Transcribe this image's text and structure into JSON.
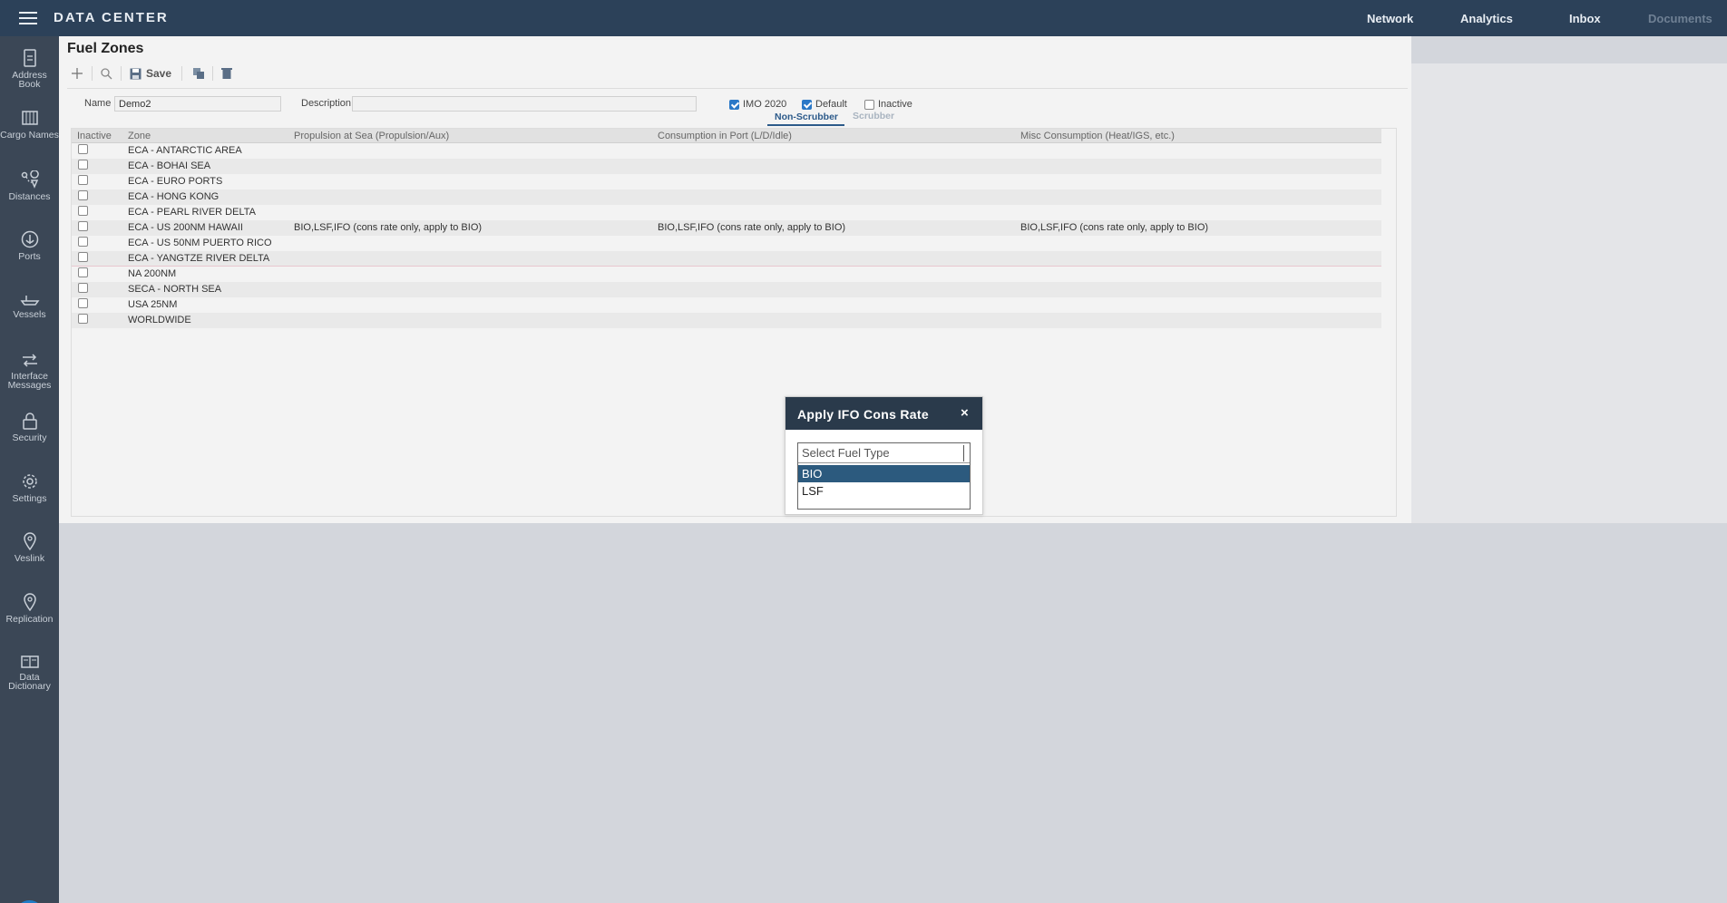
{
  "app": {
    "title": "DATA CENTER"
  },
  "topnav": [
    {
      "label": "Network"
    },
    {
      "label": "Analytics"
    },
    {
      "label": "Inbox"
    },
    {
      "label": "Documents"
    }
  ],
  "sidebar": {
    "items": [
      {
        "label": "Address Book",
        "icon": "address-book-icon"
      },
      {
        "label": "Cargo Names",
        "icon": "cargo-icon"
      },
      {
        "label": "Distances",
        "icon": "distances-icon"
      },
      {
        "label": "Ports",
        "icon": "anchor-icon"
      },
      {
        "label": "Vessels",
        "icon": "vessel-icon"
      },
      {
        "label": "Interface Messages",
        "icon": "arrows-icon"
      },
      {
        "label": "Security",
        "icon": "lock-icon"
      },
      {
        "label": "Settings",
        "icon": "gear-icon"
      },
      {
        "label": "Veslink",
        "icon": "map-pin-icon"
      },
      {
        "label": "Replication",
        "icon": "map-pin-icon"
      },
      {
        "label": "Data Dictionary",
        "icon": "book-icon"
      }
    ]
  },
  "page": {
    "title": "Fuel Zones",
    "toolbar": {
      "save_label": "Save"
    }
  },
  "form": {
    "name_label": "Name",
    "name_value": "Demo2",
    "description_label": "Description",
    "description_value": "",
    "imo2020_label": "IMO 2020",
    "imo2020_checked": true,
    "default_label": "Default",
    "default_checked": true,
    "inactive_label": "Inactive",
    "inactive_checked": false,
    "subtabs": [
      {
        "label": "Non-Scrubber",
        "active": true
      },
      {
        "label": "Scrubber",
        "active": false
      }
    ]
  },
  "grid": {
    "columns": [
      "Inactive",
      "Zone",
      "Propulsion at Sea (Propulsion/Aux)",
      "Consumption in Port (L/D/Idle)",
      "Misc Consumption (Heat/IGS, etc.)"
    ],
    "rows": [
      {
        "zone": "ECA - ANTARCTIC AREA",
        "propulsion": "",
        "port": "",
        "misc": ""
      },
      {
        "zone": "ECA - BOHAI SEA",
        "propulsion": "",
        "port": "",
        "misc": ""
      },
      {
        "zone": "ECA - EURO PORTS",
        "propulsion": "",
        "port": "",
        "misc": ""
      },
      {
        "zone": "ECA - HONG KONG",
        "propulsion": "",
        "port": "",
        "misc": ""
      },
      {
        "zone": "ECA - PEARL RIVER DELTA",
        "propulsion": "",
        "port": "",
        "misc": ""
      },
      {
        "zone": "ECA - US 200NM HAWAII",
        "propulsion": "BIO,LSF,IFO (cons rate only, apply to BIO)",
        "port": "BIO,LSF,IFO (cons rate only, apply to BIO)",
        "misc": "BIO,LSF,IFO (cons rate only, apply to BIO)"
      },
      {
        "zone": "ECA - US 50NM PUERTO RICO",
        "propulsion": "",
        "port": "",
        "misc": ""
      },
      {
        "zone": "ECA - YANGTZE RIVER DELTA",
        "propulsion": "",
        "port": "",
        "misc": ""
      },
      {
        "zone": "NA 200NM",
        "propulsion": "",
        "port": "",
        "misc": ""
      },
      {
        "zone": "SECA - NORTH SEA",
        "propulsion": "",
        "port": "",
        "misc": ""
      },
      {
        "zone": "USA 25NM",
        "propulsion": "",
        "port": "",
        "misc": ""
      },
      {
        "zone": "WORLDWIDE",
        "propulsion": "",
        "port": "",
        "misc": ""
      }
    ]
  },
  "dialog": {
    "title": "Apply IFO Cons Rate",
    "close": "×",
    "search_placeholder": "Select Fuel Type",
    "options": [
      {
        "label": "BIO",
        "selected": true
      },
      {
        "label": "LSF",
        "selected": false
      }
    ]
  },
  "colors": {
    "topbar": "#2c4159",
    "sidebar": "#3b4756",
    "accent": "#2a78c7",
    "dialog_header": "#2a3a4b",
    "selected_option": "#2c5a7e"
  }
}
